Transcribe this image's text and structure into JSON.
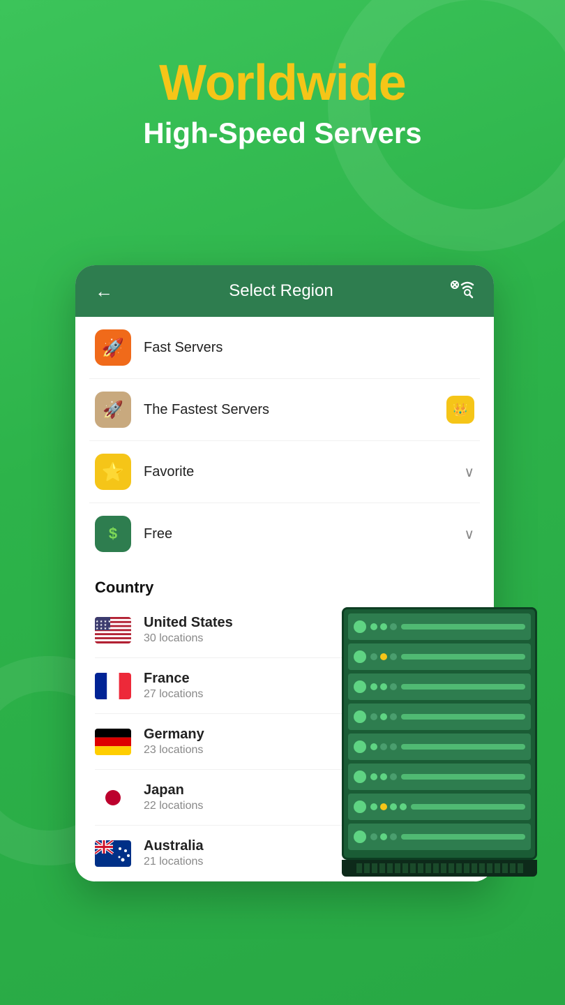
{
  "page": {
    "background_color": "#33c15a"
  },
  "header": {
    "title_line1": "Worldwide",
    "title_line2": "High-Speed Servers"
  },
  "card": {
    "header": {
      "back_label": "←",
      "title": "Select Region",
      "wifi_icon": "wifi-x-search"
    },
    "menu_items": [
      {
        "id": "fast-servers",
        "icon_type": "orange",
        "icon_symbol": "🚀",
        "label": "Fast Servers",
        "right": "none"
      },
      {
        "id": "fastest-servers",
        "icon_type": "tan",
        "icon_symbol": "🚀",
        "label": "The Fastest Servers",
        "right": "crown"
      },
      {
        "id": "favorite",
        "icon_type": "yellow",
        "icon_symbol": "⭐",
        "label": "Favorite",
        "right": "chevron"
      },
      {
        "id": "free",
        "icon_type": "green",
        "icon_symbol": "$",
        "label": "Free",
        "right": "chevron"
      }
    ],
    "country_section": {
      "label": "Country",
      "countries": [
        {
          "id": "us",
          "name": "United States",
          "locations": "30 locations",
          "flag": "us"
        },
        {
          "id": "fr",
          "name": "France",
          "locations": "27 locations",
          "flag": "fr"
        },
        {
          "id": "de",
          "name": "Germany",
          "locations": "23 locations",
          "flag": "de"
        },
        {
          "id": "jp",
          "name": "Japan",
          "locations": "22 locations",
          "flag": "jp"
        },
        {
          "id": "au",
          "name": "Australia",
          "locations": "21 locations",
          "flag": "au"
        }
      ]
    }
  },
  "server_rack": {
    "rows": [
      {
        "circle": "green",
        "dots": [
          "green",
          "green",
          "gray"
        ],
        "bar": "green"
      },
      {
        "circle": "green",
        "dots": [
          "gray",
          "yellow",
          "gray"
        ],
        "bar": "green"
      },
      {
        "circle": "green",
        "dots": [
          "green",
          "green",
          "gray"
        ],
        "bar": "green"
      },
      {
        "circle": "green",
        "dots": [
          "green",
          "yellow",
          "green"
        ],
        "bar": "green"
      },
      {
        "circle": "green",
        "dots": [
          "gray",
          "green",
          "gray"
        ],
        "bar": "green"
      },
      {
        "circle": "green",
        "dots": [
          "green",
          "green",
          "gray"
        ],
        "bar": "green"
      },
      {
        "circle": "green",
        "dots": [
          "green",
          "yellow",
          "green",
          "green"
        ],
        "bar": "green"
      },
      {
        "circle": "green",
        "dots": [
          "gray",
          "green",
          "gray"
        ],
        "bar": "green"
      }
    ]
  }
}
